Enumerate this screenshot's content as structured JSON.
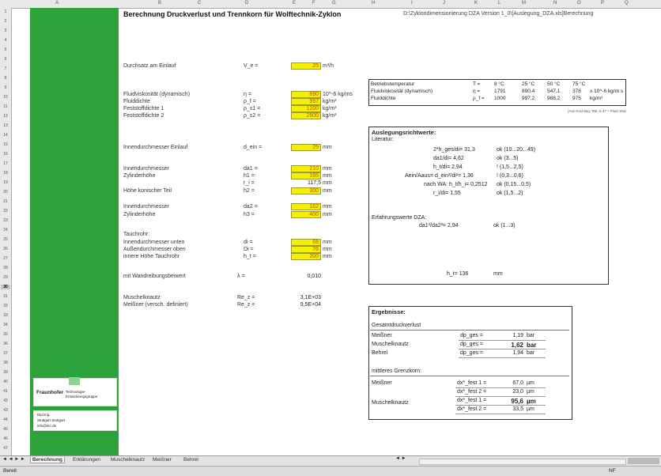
{
  "columns": [
    "A",
    "B",
    "C",
    "D",
    "E",
    "F",
    "G",
    "H",
    "I",
    "J",
    "K",
    "L",
    "M",
    "N",
    "O",
    "P",
    "Q"
  ],
  "rows": [
    "1",
    "2",
    "3",
    "4",
    "5",
    "6",
    "7",
    "8",
    "9",
    "10",
    "11",
    "12",
    "13",
    "14",
    "15",
    "16",
    "17",
    "18",
    "19",
    "20",
    "21",
    "22",
    "23",
    "24",
    "25",
    "26",
    "27",
    "28",
    "29",
    "30",
    "31",
    "32",
    "33",
    "34",
    "35",
    "36",
    "37",
    "38",
    "39",
    "40",
    "41",
    "42",
    "43",
    "44",
    "45",
    "46",
    "47"
  ],
  "selected_row": "30",
  "title": "Berechnung Druckverlust und Trennkorn für Wolftechnik-Zyklon",
  "filepath": "D:\\Zyklondimensionierung DZA Version 1_0\\[Auslegung_DZA.xls]Berechnung",
  "inputs": [
    {
      "label": "Durchsatz am Einlauf",
      "symbol": "V_e =",
      "value": "25",
      "unit": "m³/h"
    },
    {
      "label": "Fluidviskosität (dynamisch)",
      "symbol": "η =",
      "value": "890",
      "unit": "10^-6 kg/ms"
    },
    {
      "label": "Fluiddichte",
      "symbol": "ρ_f =",
      "value": "997",
      "unit": "kg/m³"
    },
    {
      "label": "Feststoffdichte 1",
      "symbol": "ρ_s1 =",
      "value": "1200",
      "unit": "kg/m³"
    },
    {
      "label": "Feststoffdichte 2",
      "symbol": "ρ_s2 =",
      "value": "2600",
      "unit": "kg/m³"
    },
    {
      "label": "Innendurchmesser Einlauf",
      "symbol": "d_ein =",
      "value": "29",
      "unit": "mm"
    },
    {
      "label": "Innendurchmesser",
      "symbol": "da1 =",
      "value": "210",
      "unit": "mm"
    },
    {
      "label": "Zylinderhöhe",
      "symbol": "h1 =",
      "value": "165",
      "unit": "mm"
    },
    {
      "label": "",
      "symbol": "r_i =",
      "value": "117,5",
      "unit": "mm"
    },
    {
      "label": "Höhe konischer Teil",
      "symbol": "h2 =",
      "value": "300",
      "unit": "mm"
    },
    {
      "label": "Innendurchmesser",
      "symbol": "da2 =",
      "value": "162",
      "unit": "mm"
    },
    {
      "label": "Zylinderhöhe",
      "symbol": "h3 =",
      "value": "400",
      "unit": "mm"
    },
    {
      "label": "Tauchrohr:",
      "symbol": "",
      "value": "",
      "unit": ""
    },
    {
      "label": "Innendurchmesser unten",
      "symbol": "di =",
      "value": "68",
      "unit": "mm"
    },
    {
      "label": "Außendurchmesser oben",
      "symbol": "Di =",
      "value": "76",
      "unit": "mm"
    },
    {
      "label": "innere Höhe Tauchrohr",
      "symbol": "h_t =",
      "value": "200",
      "unit": "mm"
    },
    {
      "label": "mit Wandreibungsbeiwert",
      "symbol": "λ =",
      "value": "0,010",
      "unit": ""
    },
    {
      "label": "Muschelknautz",
      "symbol": "Re_z =",
      "value": "3,1E+03",
      "unit": ""
    },
    {
      "label": "Meißner (versch. definiert)",
      "symbol": "Re_z =",
      "value": "9,5E+04",
      "unit": ""
    }
  ],
  "temp_table": {
    "row1": [
      "Betriebstemperatur",
      "T =",
      "8 °C",
      "25 °C",
      "50 °C",
      "75 °C"
    ],
    "row2": [
      "Fluidviskosität (dynamisch)",
      "η =",
      "1791",
      "890,4",
      "547,1",
      "378",
      "x 10^-6 kg/m s"
    ],
    "row3": [
      "Fluiddichte",
      "ρ_f =",
      "1000",
      "997,2",
      "988,2",
      "975",
      "kg/m³"
    ],
    "note": "(Aus Kuchling, Tab. 6.47 + Fluid 15a)"
  },
  "guide": {
    "title": "Auslegungsrichtwerte:",
    "subtitle": "Literatur:",
    "lines": [
      [
        "2*h_ges/di= 31,3",
        "ok (10...20...49)"
      ],
      [
        "da1/di= 4,62",
        "ok (3...5)"
      ],
      [
        "h_t/di= 2,94",
        "!  (1,5...2,5)"
      ],
      [
        "Aein/Aaus= d_ein²/di²= 1,36",
        "!  (0,3...0,6)"
      ],
      [
        "nach WA: h_t/h_i= 0,2512",
        "ok (0,15...0,5)"
      ],
      [
        "r_i/di= 1,55",
        "ok (1,5...2)"
      ]
    ],
    "exp_title": "Erfahrungswerte DZA:",
    "exp_line": [
      "da1²/da2²= 2,94",
      "ok (1...3)"
    ],
    "bottom": [
      "h_t= 136",
      "mm"
    ]
  },
  "results": {
    "title": "Ergebnisse:",
    "section1": "Gesamtdruckverlust",
    "pressure": [
      [
        "Meißner",
        "dp_ges =",
        "1,19",
        "bar"
      ],
      [
        "Muschelknautz",
        "dp_ges =",
        "1,62",
        "bar"
      ],
      [
        "Behrel",
        "dp_ges =",
        "1,94",
        "bar"
      ]
    ],
    "section2": "mittleres Grenzkorn:",
    "grain": [
      [
        "Meißner",
        "dx*_fest 1 =",
        "67,0",
        "µm"
      ],
      [
        "",
        "dx*_fest 2 =",
        "23,0",
        "µm"
      ],
      [
        "Muschelknautz",
        "dx*_fest 1 =",
        "95,6",
        "µm"
      ],
      [
        "",
        "dx*_fest 2 =",
        "33,5",
        "µm"
      ]
    ]
  },
  "logos": {
    "fraunhofer": "Fraunhofer",
    "fraunhofer_sub1": "Technologie-",
    "fraunhofer_sub2": "Entwicklungsgruppe",
    "box2_line1": "Dipl.Ing.",
    "box2_line2": "Stuttgart Stuttgart",
    "box2_line3": "info@tec.de"
  },
  "tabs": [
    "Berechnung",
    "Erklärungen",
    "Muschelknautz",
    "Meißner",
    "Behrel"
  ],
  "status": "Bereit",
  "status_right": "NF"
}
